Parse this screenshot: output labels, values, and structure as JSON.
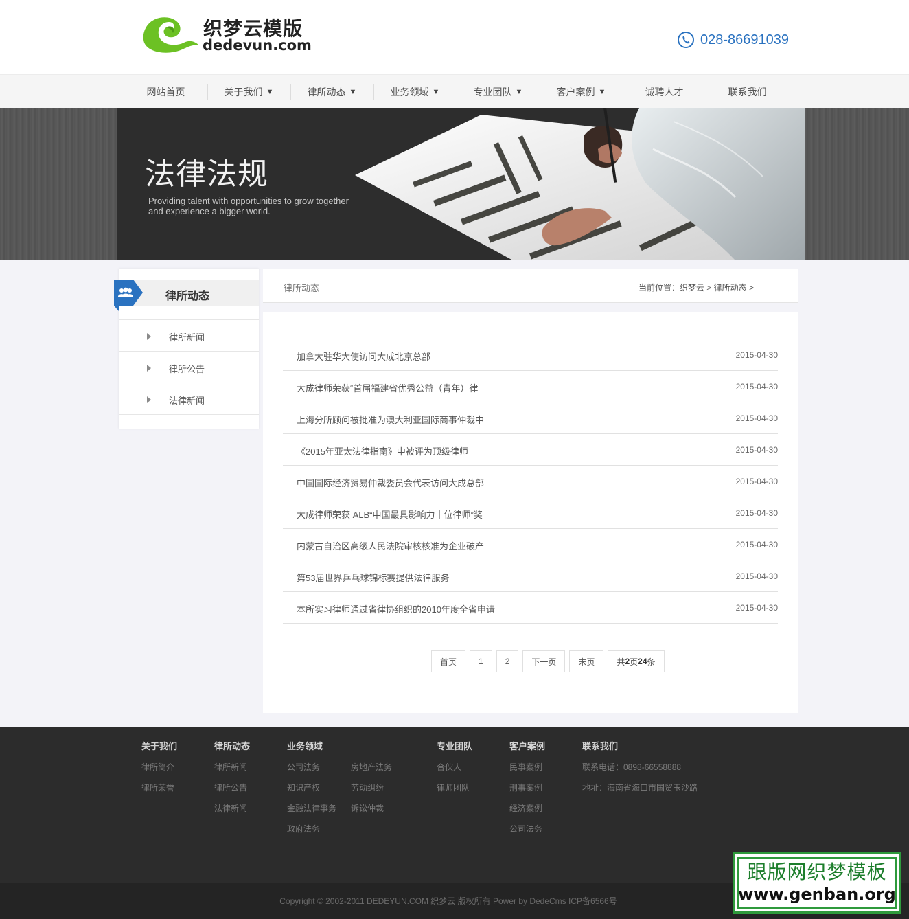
{
  "header": {
    "logo_cn": "织梦云模版",
    "logo_en": "dedevun.com",
    "phone": "028-86691039"
  },
  "nav": [
    {
      "label": "网站首页",
      "has_dropdown": false
    },
    {
      "label": "关于我们",
      "has_dropdown": true
    },
    {
      "label": "律所动态",
      "has_dropdown": true
    },
    {
      "label": "业务领域",
      "has_dropdown": true
    },
    {
      "label": "专业团队",
      "has_dropdown": true
    },
    {
      "label": "客户案例",
      "has_dropdown": true
    },
    {
      "label": "诚聘人才",
      "has_dropdown": false
    },
    {
      "label": "联系我们",
      "has_dropdown": false
    }
  ],
  "nav_arrow": "▼",
  "banner": {
    "title": "法律法规",
    "subtitle_1": "Providing talent with opportunities to grow together",
    "subtitle_2": "and experience a bigger world."
  },
  "sidebar": {
    "title": "律所动态",
    "icon": "users-icon",
    "items": [
      "律所新闻",
      "律所公告",
      "法律新闻"
    ]
  },
  "breadcrumb": {
    "section": "律所动态",
    "path": "当前位置：织梦云 > 律所动态 >"
  },
  "news": [
    {
      "title": "加拿大驻华大使访问大成北京总部",
      "date": "2015-04-30"
    },
    {
      "title": "大成律师荣获“首届福建省优秀公益（青年）律",
      "date": "2015-04-30"
    },
    {
      "title": "上海分所顾问被批准为澳大利亚国际商事仲裁中",
      "date": "2015-04-30"
    },
    {
      "title": "《2015年亚太法律指南》中被评为顶级律师",
      "date": "2015-04-30"
    },
    {
      "title": "中国国际经济贸易仲裁委员会代表访问大成总部",
      "date": "2015-04-30"
    },
    {
      "title": "大成律师荣获 ALB“中国最具影响力十位律师”奖",
      "date": "2015-04-30"
    },
    {
      "title": "内蒙古自治区高级人民法院审核核准为企业破产",
      "date": "2015-04-30"
    },
    {
      "title": "第53届世界乒乓球锦标赛提供法律服务",
      "date": "2015-04-30"
    },
    {
      "title": "本所实习律师通过省律协组织的2010年度全省申请",
      "date": "2015-04-30"
    }
  ],
  "pager": {
    "first": "首页",
    "page1": "1",
    "page2": "2",
    "next": "下一页",
    "last": "末页",
    "info_prefix": "共 ",
    "total_pages": "2",
    "info_mid": "页",
    "total_items": "24",
    "info_suffix": "条"
  },
  "footer": {
    "about": {
      "title": "关于我们",
      "links": [
        "律所简介",
        "律所荣誉"
      ]
    },
    "news": {
      "title": "律所动态",
      "links": [
        "律所新闻",
        "律所公告",
        "法律新闻"
      ]
    },
    "business": {
      "title": "业务领域",
      "links_a": [
        "公司法务",
        "知识产权",
        "金融法律事务",
        "政府法务"
      ],
      "links_b": [
        "房地产法务",
        "劳动纠纷",
        "诉讼仲裁"
      ]
    },
    "team": {
      "title": "专业团队",
      "links": [
        "合伙人",
        "律师团队"
      ]
    },
    "cases": {
      "title": "客户案例",
      "links": [
        "民事案例",
        "刑事案例",
        "经济案例",
        "公司法务"
      ]
    },
    "contact": {
      "title": "联系我们",
      "phone": "联系电话：0898-66558888",
      "address": "地址：海南省海口市国贸玉沙路"
    },
    "copyright": "Copyright © 2002-2011 DEDEYUN.COM 织梦云 版权所有 Power by DedeCms ICP备6566号"
  },
  "watermark": {
    "cn": "跟版网织梦模板",
    "en": "www.genban.org"
  },
  "colors": {
    "accent_blue": "#2a72c0",
    "logo_green": "#6cc124",
    "footer_bg": "#2c2c2c",
    "watermark_green": "#2f9a3c"
  }
}
